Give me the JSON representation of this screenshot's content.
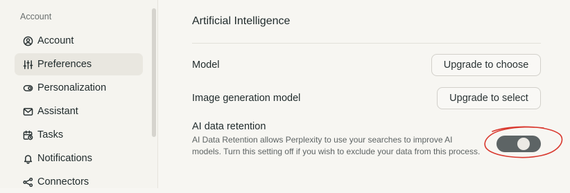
{
  "sidebar": {
    "section_label": "Account",
    "items": [
      {
        "label": "Account",
        "icon": "user-circle-icon"
      },
      {
        "label": "Preferences",
        "icon": "sliders-icon",
        "active": true
      },
      {
        "label": "Personalization",
        "icon": "toggle-icon"
      },
      {
        "label": "Assistant",
        "icon": "mail-icon"
      },
      {
        "label": "Tasks",
        "icon": "calendar-clock-icon"
      },
      {
        "label": "Notifications",
        "icon": "bell-icon"
      },
      {
        "label": "Connectors",
        "icon": "connectors-icon"
      }
    ]
  },
  "main": {
    "section_title": "Artificial Intelligence",
    "model": {
      "label": "Model",
      "button": "Upgrade to choose"
    },
    "image_model": {
      "label": "Image generation model",
      "button": "Upgrade to select"
    },
    "retention": {
      "label": "AI data retention",
      "description": "AI Data Retention allows Perplexity to use your searches to improve AI models. Turn this setting off if you wish to exclude your data from this process.",
      "enabled": true
    }
  },
  "colors": {
    "annotation_circle": "#d9382e",
    "toggle_track": "#5d6465"
  }
}
